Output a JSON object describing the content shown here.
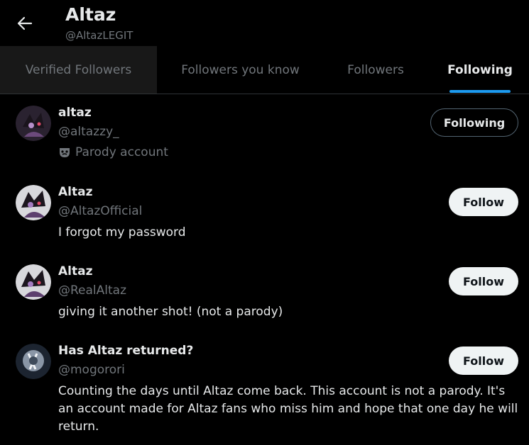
{
  "header": {
    "title": "Altaz",
    "handle": "@AltazLEGIT",
    "back_icon": "arrow-left-icon"
  },
  "tabs": [
    {
      "label": "Verified Followers"
    },
    {
      "label": "Followers you know"
    },
    {
      "label": "Followers"
    },
    {
      "label": "Following",
      "active": true
    }
  ],
  "accounts": [
    {
      "name": "altaz",
      "handle": "@altazzy_",
      "badge_text": "Parody account",
      "badge_icon": "mask-icon",
      "button": "Following"
    },
    {
      "name": "Altaz",
      "handle": "@AltazOfficial",
      "bio": "I forgot my password",
      "button": "Follow"
    },
    {
      "name": "Altaz",
      "handle": "@RealAltaz",
      "bio": "giving it another shot! (not a parody)",
      "button": "Follow"
    },
    {
      "name": "Has Altaz returned?",
      "handle": "@mogorori",
      "bio": "Counting the days until Altaz come back. This account is not a parody. It's an account made for Altaz fans who miss him and hope that one day he will return.",
      "button": "Follow"
    }
  ],
  "colors": {
    "background": "#000000",
    "accent": "#1d9bf0",
    "text": "#e7e9ea",
    "muted": "#71767b"
  }
}
